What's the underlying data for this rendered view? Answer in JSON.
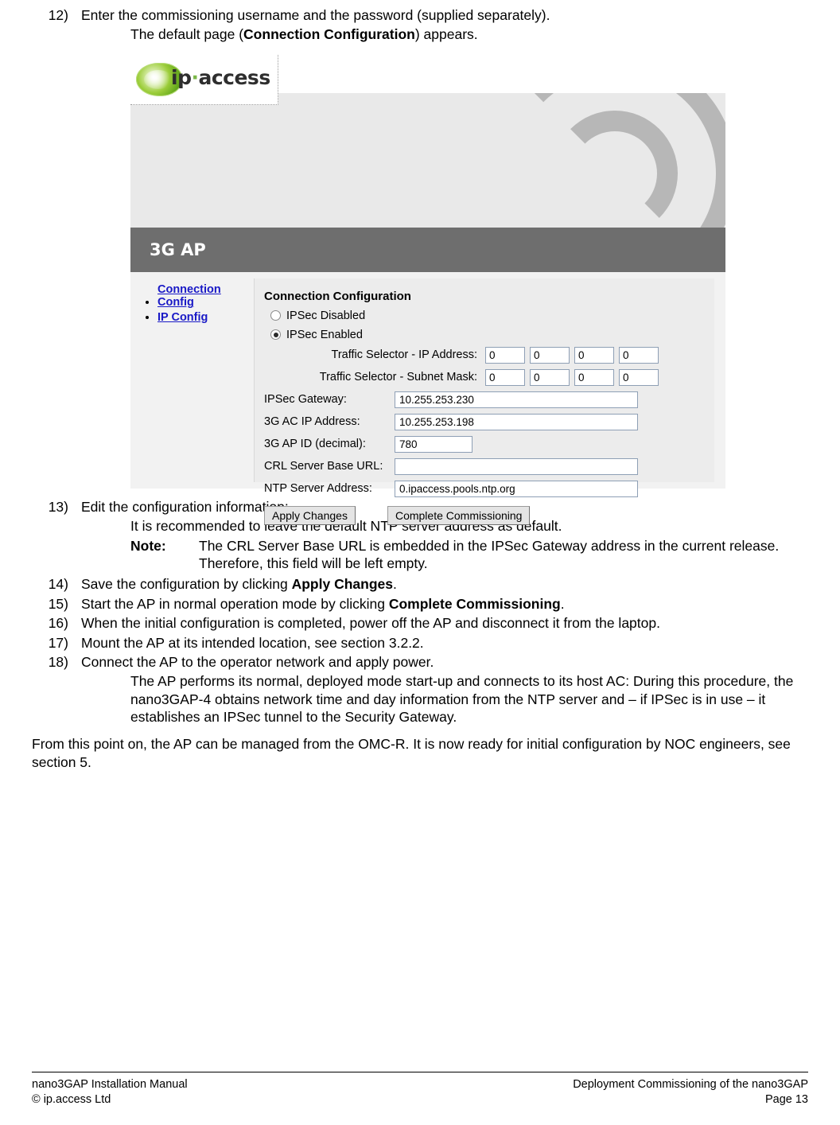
{
  "steps": [
    {
      "num": "12)",
      "text": "Enter the commissioning username and the password (supplied separately)."
    },
    {
      "num": "13)",
      "text": "Edit the configuration information:"
    },
    {
      "num": "14)",
      "text_before": "Save the configuration by clicking ",
      "bold": "Apply Changes",
      "text_after": "."
    },
    {
      "num": "15)",
      "text_before": "Start the AP in normal operation mode by clicking ",
      "bold": "Complete Commissioning",
      "text_after": "."
    },
    {
      "num": "16)",
      "text": "When the initial configuration is completed, power off the AP and disconnect it from the laptop."
    },
    {
      "num": "17)",
      "text": "Mount the AP at its intended location, see section 3.2.2."
    },
    {
      "num": "18)",
      "text": "Connect the AP to the operator network and apply power."
    }
  ],
  "sub_text": {
    "default_page_before": "The default page (",
    "default_page_bold": "Connection Configuration",
    "default_page_after": ") appears.",
    "ntp_recommend": "It is recommended to leave the default NTP server address as default.",
    "note_label": "Note:",
    "note_body": "The CRL Server Base URL is embedded in the IPSec Gateway address in the current release. Therefore, this field will be left empty.",
    "ap_performs": "The AP performs its normal, deployed mode start-up and connects to its host AC: During this procedure, the nano3GAP-4 obtains network time and day information from the NTP server and – if IPSec is in use – it establishes an IPSec tunnel to the Security Gateway.",
    "closing": "From this point on, the AP can be managed from the OMC-R. It is now ready for initial configuration by NOC engineers, see section 5."
  },
  "figure": {
    "logo_text_a": "ip",
    "logo_text_dot": "·",
    "logo_text_b": "access",
    "banner_title": "3G AP",
    "nav": [
      {
        "label": "Connection Config"
      },
      {
        "label": "IP Config"
      }
    ],
    "panel_title": "Connection Configuration",
    "radios": [
      {
        "label": "IPSec Disabled",
        "selected": false
      },
      {
        "label": "IPSec Enabled",
        "selected": true
      }
    ],
    "selectors": [
      {
        "label": "Traffic Selector - IP Address:",
        "octets": [
          "0",
          "0",
          "0",
          "0"
        ]
      },
      {
        "label": "Traffic Selector - Subnet Mask:",
        "octets": [
          "0",
          "0",
          "0",
          "0"
        ]
      }
    ],
    "fields": [
      {
        "label": "IPSec Gateway:",
        "value": "10.255.253.230",
        "size": "long"
      },
      {
        "label": "3G AC IP Address:",
        "value": "10.255.253.198",
        "size": "long"
      },
      {
        "label": "3G AP ID (decimal):",
        "value": "780",
        "size": "short"
      },
      {
        "label": "CRL Server Base URL:",
        "value": "",
        "size": "long"
      },
      {
        "label": "NTP Server Address:",
        "value": "0.ipaccess.pools.ntp.org",
        "size": "long"
      }
    ],
    "buttons": [
      {
        "label": "Apply Changes"
      },
      {
        "label": "Complete Commissioning"
      }
    ]
  },
  "footer": {
    "left_line1": "nano3GAP Installation Manual",
    "left_line2": "© ip.access Ltd",
    "right_line1": "Deployment Commissioning of the nano3GAP",
    "right_line2": "Page 13"
  }
}
